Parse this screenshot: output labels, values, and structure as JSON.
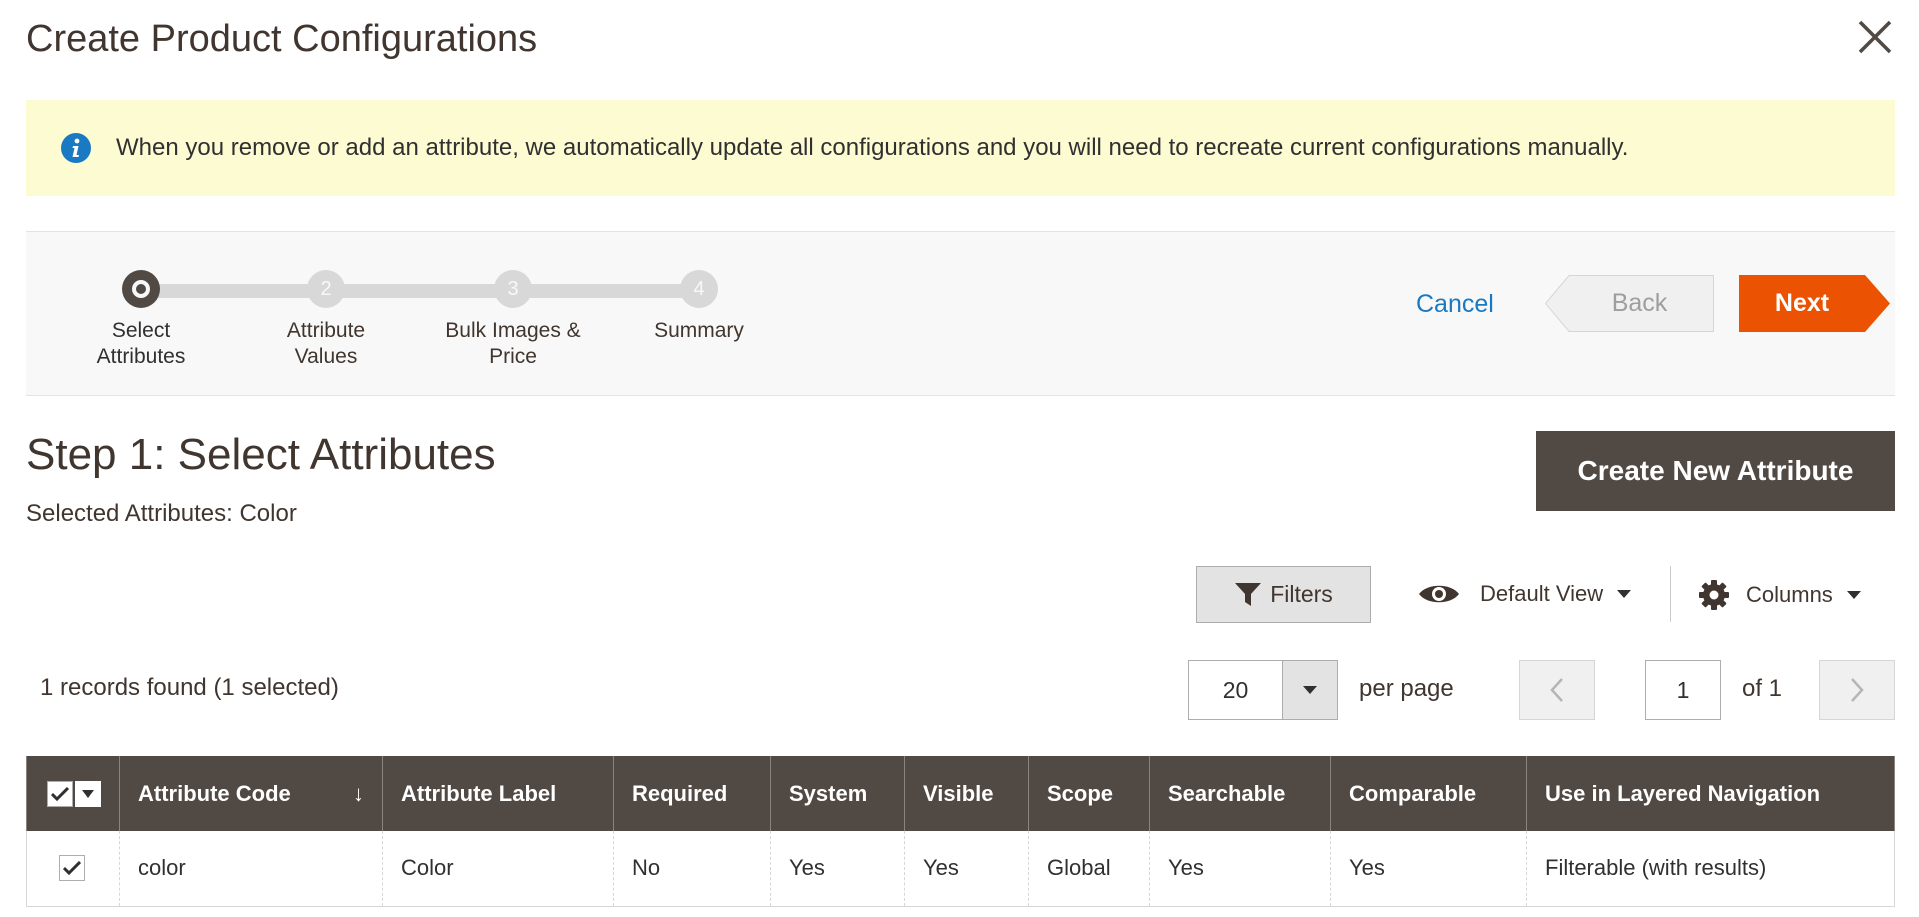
{
  "modal": {
    "title": "Create Product Configurations",
    "close_icon": "close-icon"
  },
  "notice": {
    "icon": "info-icon",
    "text": "When you remove or add an attribute, we automatically update all configurations and you will need to recreate current configurations manually."
  },
  "wizard": {
    "steps": [
      {
        "number": "",
        "label_line1": "Select",
        "label_line2": "Attributes",
        "active": true
      },
      {
        "number": "2",
        "label_line1": "Attribute",
        "label_line2": "Values",
        "active": false
      },
      {
        "number": "3",
        "label_line1": "Bulk Images &",
        "label_line2": "Price",
        "active": false
      },
      {
        "number": "4",
        "label_line1": "Summary",
        "label_line2": "",
        "active": false
      }
    ],
    "cancel_label": "Cancel",
    "back_label": "Back",
    "next_label": "Next"
  },
  "step": {
    "heading": "Step 1: Select Attributes",
    "selected_attributes": "Selected Attributes: Color",
    "create_button": "Create New Attribute"
  },
  "toolbar": {
    "filters_label": "Filters",
    "view_label": "Default View",
    "columns_label": "Columns",
    "records_text": "1 records found (1 selected)",
    "per_page_value": "20",
    "per_page_label": "per page",
    "current_page": "1",
    "of_pages": "of 1"
  },
  "grid": {
    "columns": [
      "Attribute Code",
      "Attribute Label",
      "Required",
      "System",
      "Visible",
      "Scope",
      "Searchable",
      "Comparable",
      "Use in Layered Navigation"
    ],
    "sort_indicator": "↓",
    "rows": [
      {
        "checked": true,
        "cells": [
          "color",
          "Color",
          "No",
          "Yes",
          "Yes",
          "Global",
          "Yes",
          "Yes",
          "Filterable (with results)"
        ]
      }
    ]
  },
  "colors": {
    "accent_orange": "#eb5202",
    "link_blue": "#1979c3",
    "header_dark": "#514943",
    "notice_bg": "#fdfbd2"
  }
}
